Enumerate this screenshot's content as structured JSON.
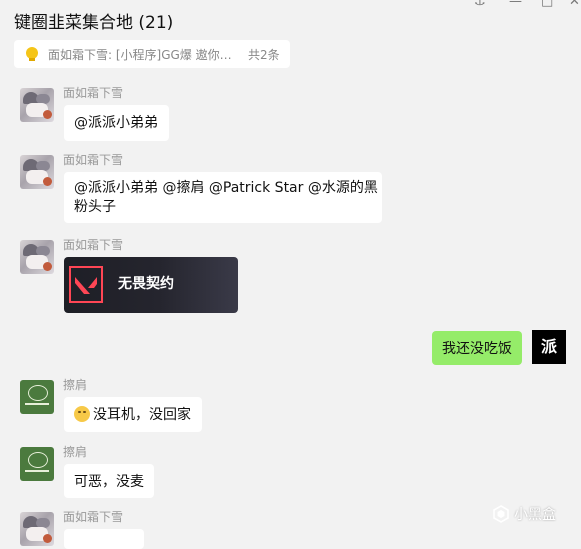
{
  "window": {
    "title": "键圈韭菜集合地 (21)",
    "controls": {
      "pin": "⚓",
      "minimize": "—",
      "maximize": "□",
      "close": "✕"
    }
  },
  "pinned_bar": {
    "icon": "lightbulb-icon",
    "text": "面如霜下雪: [小程序]GG爆 遨你免...",
    "count": "共2条"
  },
  "messages": [
    {
      "sender": "面如霜下雪",
      "text": "@派派小弟弟"
    },
    {
      "sender": "面如霜下雪",
      "lines": [
        "@派派小弟弟 @擦肩 @Patrick Star @水源的黑",
        "粉头子"
      ]
    },
    {
      "sender": "面如霜下雪",
      "card_title": "无畏契约"
    },
    {
      "self_avatar": "派",
      "text": "我还没吃饭"
    },
    {
      "sender": "擦肩",
      "text": "没耳机，没回家"
    },
    {
      "sender": "擦肩",
      "text": "可恶，没麦"
    },
    {
      "sender": "面如霜下雪"
    }
  ],
  "watermark": {
    "text": "小黑盒"
  },
  "colors": {
    "self_bubble": "#95ec69",
    "valorant_red": "#ff4655",
    "background": "#f2f2f2"
  }
}
